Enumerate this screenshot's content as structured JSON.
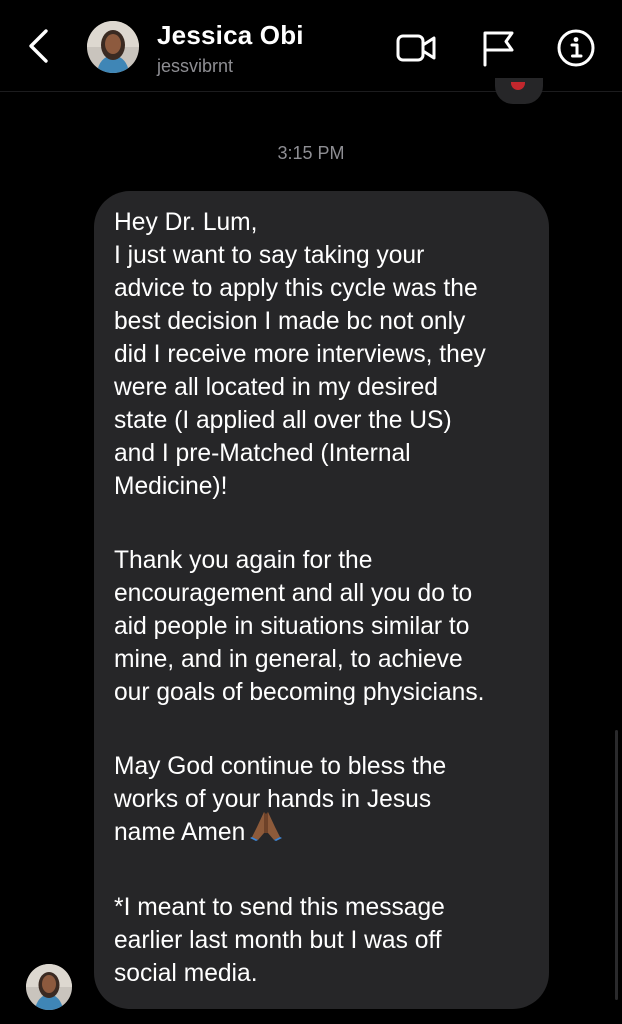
{
  "header": {
    "name": "Jessica Obi",
    "username": "jessvibrnt"
  },
  "timestamp": "3:15 PM",
  "message": {
    "paragraphs": [
      "Hey Dr. Lum,\nI just want to say taking your\nadvice to apply this cycle was the\nbest decision I made bc not only\ndid I receive more interviews, they\nwere all located in my desired\nstate (I applied all over the US)\nand I pre-Matched (Internal\nMedicine)!",
      "Thank you again for the\nencouragement and all you do to\naid people in situations similar to\nmine, and in general, to achieve\nour goals of becoming physicians.",
      "May God continue to bless the\nworks of your hands in Jesus\nname Amen",
      "*I meant to send this message\nearlier last month but I was off\nsocial media."
    ]
  },
  "icons": {
    "back": "chevron-left-icon",
    "video": "video-camera-icon",
    "flag": "flag-icon",
    "info": "info-icon",
    "emoji": "folded-hands-emoji"
  },
  "colors": {
    "background": "#000000",
    "bubble": "#262628",
    "text": "#ffffff",
    "secondary_text": "#8e8e93",
    "reaction_heart": "#c2272d",
    "emoji_skin": "#8d5a3a"
  }
}
